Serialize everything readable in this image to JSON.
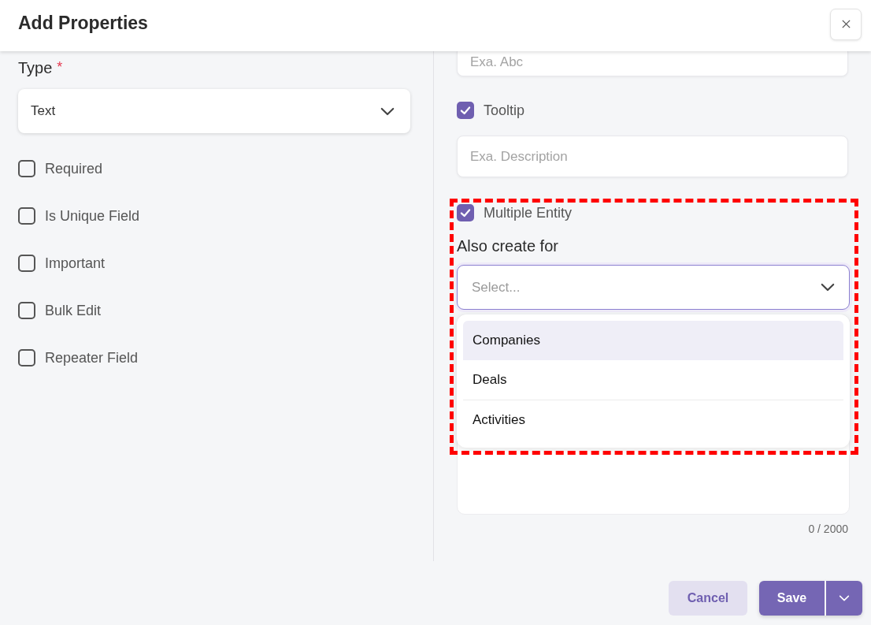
{
  "dialog": {
    "title": "Add Properties"
  },
  "type_field": {
    "label": "Type",
    "required_mark": "*",
    "value": "Text"
  },
  "options": [
    {
      "label": "Required",
      "checked": false
    },
    {
      "label": "Is Unique Field",
      "checked": false
    },
    {
      "label": "Important",
      "checked": false
    },
    {
      "label": "Bulk Edit",
      "checked": false
    },
    {
      "label": "Repeater Field",
      "checked": false
    }
  ],
  "name_field": {
    "placeholder": "Exa. Abc"
  },
  "tooltip": {
    "label": "Tooltip",
    "checked": true,
    "placeholder": "Exa. Description"
  },
  "multiple_entity": {
    "label": "Multiple Entity",
    "checked": true
  },
  "also_create_for": {
    "label": "Also create for",
    "placeholder": "Select...",
    "open": true,
    "options": [
      {
        "label": "Companies",
        "selected": true
      },
      {
        "label": "Deals",
        "selected": false
      },
      {
        "label": "Activities",
        "selected": false
      }
    ]
  },
  "description": {
    "counter": "0 / 2000"
  },
  "buttons": {
    "cancel": "Cancel",
    "save": "Save"
  }
}
